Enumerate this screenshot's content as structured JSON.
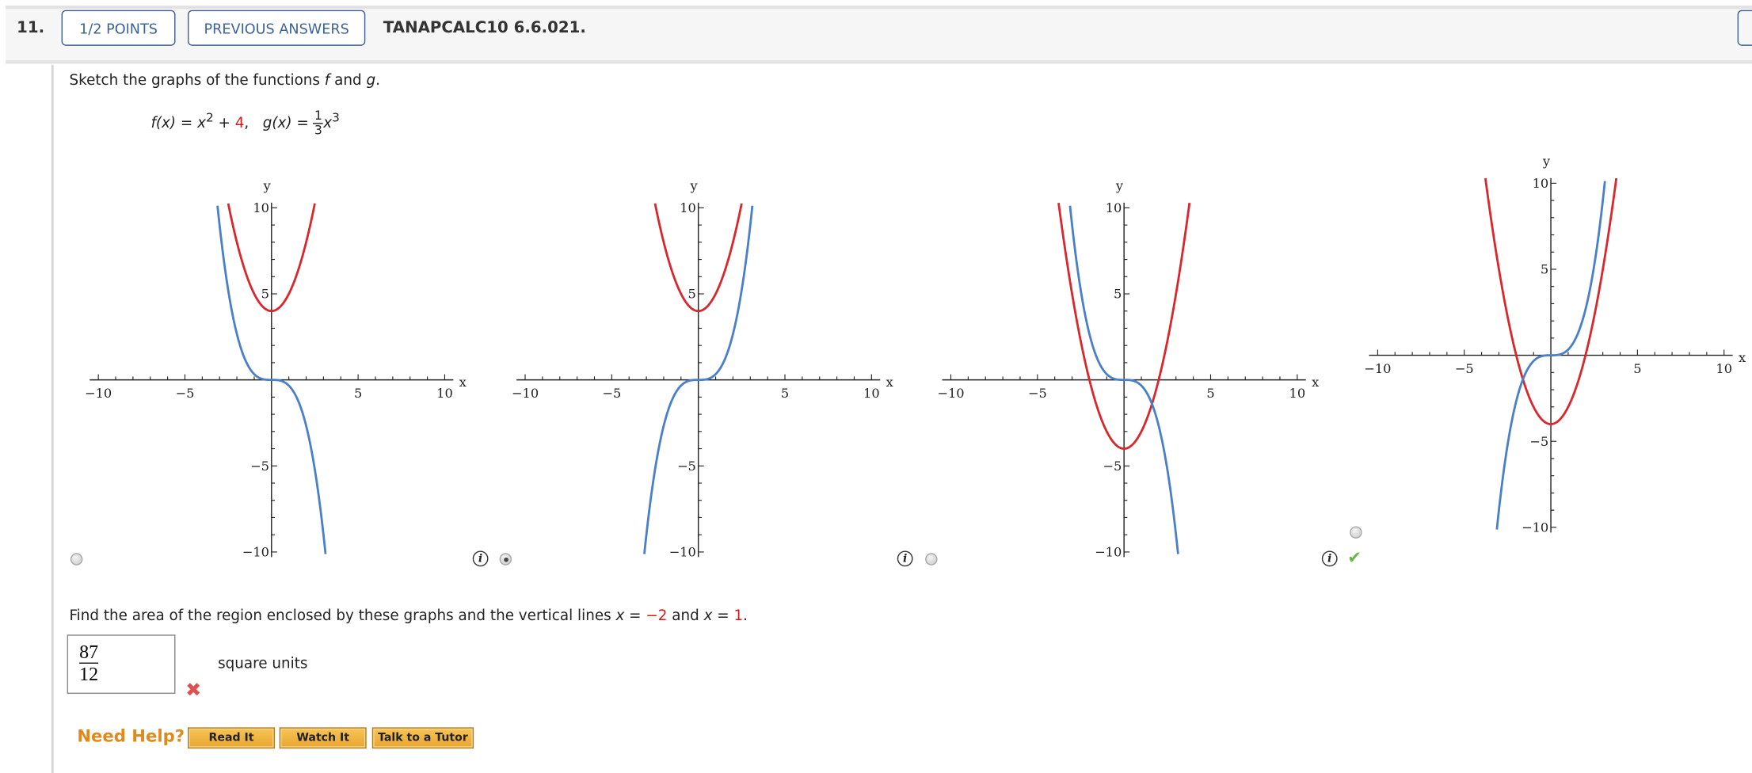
{
  "header": {
    "question_number": "11.",
    "points_label": "1/2 POINTS",
    "previous_answers_label": "PREVIOUS ANSWERS",
    "question_id": "TANAPCALC10 6.6.021."
  },
  "question": {
    "prompt": "Sketch the graphs of the functions f and g.",
    "prompt_pre": "Sketch the graphs of the functions ",
    "f_var": "f",
    "and": " and ",
    "g_var": "g",
    "period": ".",
    "f_lhs": "f(x) = x",
    "f_exp": "2",
    "f_plus": " + ",
    "f_const": "4",
    "comma": ",",
    "g_lhs": "g(x) = ",
    "g_num": "1",
    "g_den": "3",
    "g_x": "x",
    "g_exp": "3"
  },
  "options": [
    {
      "selected": false,
      "has_info": false,
      "feedback": ""
    },
    {
      "selected": true,
      "has_info": true,
      "feedback": ""
    },
    {
      "selected": false,
      "has_info": true,
      "feedback": ""
    },
    {
      "selected": false,
      "has_info": true,
      "feedback": "correct"
    }
  ],
  "chart_data": [
    {
      "type": "line",
      "xlabel": "x",
      "ylabel": "y",
      "xlim": [
        -10,
        10
      ],
      "ylim": [
        -10,
        10
      ],
      "xticks": [
        -10,
        -5,
        5,
        10
      ],
      "yticks": [
        10,
        5,
        -5,
        -10
      ],
      "series": [
        {
          "color": "#d9272e",
          "expr": "x*x+4"
        },
        {
          "color": "#4a80c8",
          "expr": "-x*x*x/3"
        }
      ]
    },
    {
      "type": "line",
      "xlabel": "x",
      "ylabel": "y",
      "xlim": [
        -10,
        10
      ],
      "ylim": [
        -10,
        10
      ],
      "xticks": [
        -10,
        -5,
        5,
        10
      ],
      "yticks": [
        10,
        5,
        -5,
        -10
      ],
      "series": [
        {
          "color": "#d9272e",
          "expr": "x*x+4"
        },
        {
          "color": "#4a80c8",
          "expr": "x*x*x/3"
        }
      ]
    },
    {
      "type": "line",
      "xlabel": "x",
      "ylabel": "y",
      "xlim": [
        -10,
        10
      ],
      "ylim": [
        -10,
        10
      ],
      "xticks": [
        -10,
        -5,
        5,
        10
      ],
      "yticks": [
        10,
        5,
        -5,
        -10
      ],
      "series": [
        {
          "color": "#d9272e",
          "expr": "x*x-4"
        },
        {
          "color": "#4a80c8",
          "expr": "-x*x*x/3"
        }
      ]
    },
    {
      "type": "line",
      "xlabel": "x",
      "ylabel": "y",
      "xlim": [
        -10,
        10
      ],
      "ylim": [
        -10,
        10
      ],
      "xticks": [
        -10,
        -5,
        5,
        10
      ],
      "yticks": [
        10,
        5,
        -5,
        -10
      ],
      "series": [
        {
          "color": "#d9272e",
          "expr": "x*x-4"
        },
        {
          "color": "#4a80c8",
          "expr": "x*x*x/3"
        }
      ]
    }
  ],
  "area_question": {
    "pre": "Find the area of the region enclosed by these graphs and the vertical lines ",
    "x1_lhs": "x = ",
    "x1_val": "−2",
    "and": " and ",
    "x2_lhs": "x = ",
    "x2_val": "1",
    "period": "."
  },
  "answer": {
    "numerator": "87",
    "denominator": "12",
    "units": "square units",
    "status": "incorrect"
  },
  "help": {
    "label": "Need Help?",
    "read_it": "Read It",
    "watch_it": "Watch It",
    "talk_to_tutor": "Talk to a Tutor"
  }
}
